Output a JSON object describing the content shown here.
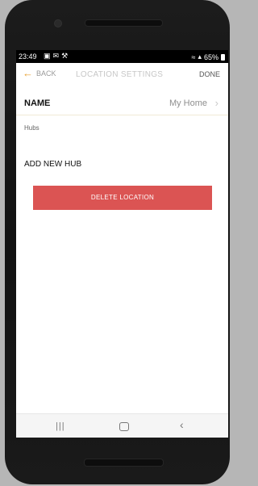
{
  "status_bar": {
    "time": "23:49",
    "battery": "65%",
    "icons": [
      "image-icon",
      "mail-icon",
      "wrench-icon",
      "wifi-icon",
      "signal-icon",
      "battery-icon"
    ]
  },
  "nav": {
    "back_label": "BACK",
    "title": "LOCATION SETTINGS",
    "done_label": "DONE",
    "accent_color": "#e8a030"
  },
  "location": {
    "name_label": "NAME",
    "name_value": "My Home",
    "hubs_label": "Hubs",
    "add_hub_label": "ADD NEW HUB",
    "delete_label": "DELETE LOCATION",
    "delete_color": "#db5453"
  },
  "system_nav": {
    "icons": [
      "recents-icon",
      "home-icon",
      "back-icon"
    ]
  }
}
